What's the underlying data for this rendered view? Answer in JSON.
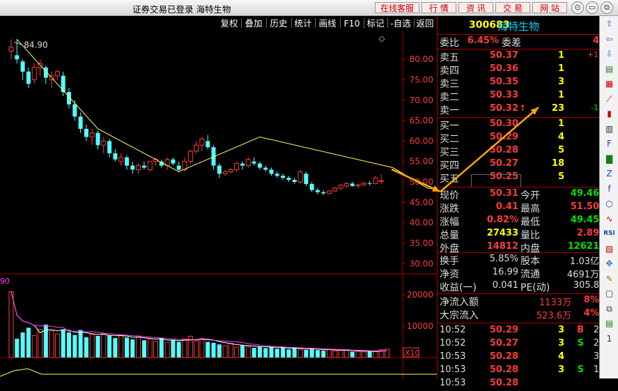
{
  "titlebar": {
    "title": "证券交易已登录  海特生物",
    "buttons": [
      "在线客服",
      "行 情",
      "资 讯",
      "交 易",
      "网 站"
    ],
    "win": [
      "⊙",
      "▭",
      "⧉",
      "✕"
    ]
  },
  "toolbar": {
    "items": [
      "复权",
      "叠加",
      "历史",
      "统计",
      "画线",
      "F10",
      "标记",
      "-自选",
      "返回"
    ]
  },
  "chart": {
    "price_ticks": [
      "80.00",
      "75.00",
      "70.00",
      "65.00",
      "60.00",
      "55.00",
      "50.00",
      "45.00",
      "40.00",
      "35.00",
      "30.00"
    ],
    "vol_ticks": [
      "20000",
      "10000"
    ],
    "vol_unit": "X10",
    "high_label": "84.90",
    "vol_corner": "90",
    "accent": "#ff3b3b"
  },
  "chart_data": {
    "type": "candlestick",
    "ylim": [
      28,
      86
    ],
    "candles": [
      [
        82,
        84.9,
        80,
        83
      ],
      [
        81,
        85,
        79,
        80
      ],
      [
        79.5,
        80,
        75,
        77
      ],
      [
        77,
        78,
        73,
        74
      ],
      [
        75,
        79,
        74,
        78
      ],
      [
        78,
        80,
        76,
        79
      ],
      [
        78,
        78.5,
        74,
        75.5
      ],
      [
        75,
        77,
        73,
        76
      ],
      [
        76,
        77.5,
        75,
        77
      ],
      [
        76,
        77,
        71,
        72
      ],
      [
        72,
        73,
        68,
        69
      ],
      [
        69,
        70,
        65,
        66
      ],
      [
        66,
        67,
        62,
        63
      ],
      [
        63,
        64,
        60,
        61
      ],
      [
        61,
        63,
        59,
        62
      ],
      [
        62,
        62.5,
        58,
        59
      ],
      [
        59,
        61,
        57,
        60
      ],
      [
        60,
        60.5,
        56,
        57
      ],
      [
        57,
        58,
        55,
        55.5
      ],
      [
        55,
        57,
        54,
        56
      ],
      [
        56,
        56.5,
        53,
        54
      ],
      [
        54,
        55,
        52,
        53
      ],
      [
        53,
        54.5,
        52,
        54
      ],
      [
        54,
        55,
        53,
        53.5
      ],
      [
        53,
        55,
        52.5,
        55
      ],
      [
        55,
        56,
        54,
        55.5
      ],
      [
        55,
        55.5,
        53.5,
        54
      ],
      [
        54,
        56,
        53,
        55.5
      ],
      [
        55.5,
        56,
        54,
        54.5
      ],
      [
        54,
        55,
        52.5,
        53
      ],
      [
        53,
        56,
        52.5,
        55
      ],
      [
        55,
        58,
        54.5,
        57.5
      ],
      [
        57.5,
        60,
        57,
        59
      ],
      [
        59,
        61,
        57.5,
        60.5
      ],
      [
        60,
        61.5,
        58,
        58.5
      ],
      [
        58.5,
        59,
        53,
        54
      ],
      [
        54,
        54.5,
        51,
        52
      ],
      [
        52,
        53,
        51.5,
        52.5
      ],
      [
        52.5,
        53.5,
        52,
        53
      ],
      [
        53,
        55,
        52.5,
        54.5
      ],
      [
        54.5,
        55,
        53,
        54
      ],
      [
        54,
        56,
        53.5,
        55.5
      ],
      [
        55,
        56,
        54,
        54.5
      ],
      [
        54.5,
        55,
        53,
        53.5
      ],
      [
        53.5,
        54,
        52.5,
        53
      ],
      [
        53,
        53.5,
        51.5,
        52
      ],
      [
        52,
        52.5,
        51,
        51.5
      ],
      [
        51.5,
        52,
        50.5,
        51
      ],
      [
        51,
        51.5,
        50,
        50.5
      ],
      [
        50.5,
        51,
        49.5,
        50
      ],
      [
        50,
        53,
        49.5,
        52.5
      ],
      [
        52,
        52.5,
        49,
        49.5
      ],
      [
        49.5,
        50,
        47.5,
        48
      ],
      [
        48,
        48.5,
        47,
        47.5
      ],
      [
        47.5,
        48,
        46.8,
        47.2
      ],
      [
        47.2,
        48,
        47,
        47.8
      ],
      [
        47.8,
        48.8,
        47.5,
        48.5
      ],
      [
        48.5,
        49.5,
        48,
        49.2
      ],
      [
        49,
        50,
        48.5,
        49.6
      ],
      [
        49.6,
        50,
        48.8,
        49
      ],
      [
        49,
        49.6,
        48.6,
        49.3
      ],
      [
        49.3,
        50,
        48.9,
        49.7
      ],
      [
        49.7,
        50.3,
        49.2,
        49.6
      ],
      [
        49.6,
        51.5,
        49.4,
        51
      ],
      [
        50.2,
        51.8,
        49.4,
        50.31
      ]
    ],
    "lines": [
      {
        "name": "",
        "points": [
          [
            1,
            84.9
          ],
          [
            15,
            63
          ],
          [
            29,
            52.5
          ],
          [
            43,
            61
          ],
          [
            66,
            53.5
          ],
          [
            72,
            48.5
          ],
          [
            83,
            46.8
          ],
          [
            96,
            51.8
          ]
        ]
      }
    ],
    "volume": [
      21000,
      6000,
      8000,
      9500,
      7000,
      9000,
      10500,
      8500,
      7500,
      9000,
      8000,
      7200,
      8800,
      6500,
      7400,
      6900,
      7600,
      7000,
      6200,
      7100,
      6400,
      5800,
      6900,
      5500,
      6000,
      5200,
      6300,
      4800,
      5600,
      5000,
      5900,
      6800,
      5400,
      6100,
      5000,
      4700,
      4200,
      3800,
      4500,
      3300,
      3900,
      3500,
      3100,
      3600,
      3000,
      3400,
      2800,
      3200,
      2600,
      3100,
      2700,
      2500,
      2900,
      2400,
      2200,
      2600,
      2100,
      2300,
      2400,
      1900,
      2000,
      1800,
      2100,
      1900,
      2500,
      2700
    ],
    "vol_ylim": [
      0,
      26000
    ]
  },
  "quote": {
    "code": "300683",
    "name": "海特生物",
    "weibi_label": "委比",
    "weibi_val": "6.45%",
    "weicha_label": "委差",
    "weicha_val": "4",
    "asks": [
      {
        "label": "卖五",
        "price": "50.37",
        "vol": "1",
        "chg": "+1",
        "chg_cls": "red",
        "arrow": ""
      },
      {
        "label": "卖四",
        "price": "50.36",
        "vol": "1",
        "chg": "",
        "chg_cls": "",
        "arrow": ""
      },
      {
        "label": "卖三",
        "price": "50.35",
        "vol": "3",
        "chg": "",
        "chg_cls": "",
        "arrow": ""
      },
      {
        "label": "卖二",
        "price": "50.33",
        "vol": "1",
        "chg": "",
        "chg_cls": "",
        "arrow": ""
      },
      {
        "label": "卖一",
        "price": "50.32",
        "vol": "23",
        "chg": "-1",
        "chg_cls": "grn",
        "arrow": "↑"
      }
    ],
    "bids": [
      {
        "label": "买一",
        "price": "50.30",
        "vol": "1"
      },
      {
        "label": "买二",
        "price": "50.29",
        "vol": "4"
      },
      {
        "label": "买三",
        "price": "50.28",
        "vol": "5"
      },
      {
        "label": "买四",
        "price": "50.27",
        "vol": "18"
      },
      {
        "label": "买五",
        "price": "50.25",
        "vol": "5"
      }
    ],
    "stats1": [
      {
        "l1": "现价",
        "v1": "50.31",
        "c1": "red",
        "l2": "今开",
        "v2": "49.46",
        "c2": "grn"
      },
      {
        "l1": "涨跌",
        "v1": "0.41",
        "c1": "red",
        "l2": "最高",
        "v2": "51.50",
        "c2": "red"
      },
      {
        "l1": "涨幅",
        "v1": "0.82%",
        "c1": "red",
        "l2": "最低",
        "v2": "49.45",
        "c2": "grn"
      },
      {
        "l1": "总量",
        "v1": "27433",
        "c1": "yel",
        "l2": "量比",
        "v2": "2.89",
        "c2": "red"
      },
      {
        "l1": "外盘",
        "v1": "14812",
        "c1": "red",
        "l2": "内盘",
        "v2": "12621",
        "c2": "grn"
      }
    ],
    "stats2": [
      {
        "l1": "换手",
        "v1": "5.85%",
        "l2": "股本",
        "v2": "1.03亿"
      },
      {
        "l1": "净资",
        "v1": "16.99",
        "l2": "流通",
        "v2": "4691万"
      },
      {
        "l1": "收益(一)",
        "v1": "0.041",
        "l2": "PE(动)",
        "v2": "305.8"
      }
    ],
    "flow": [
      {
        "label": "净流入额",
        "val": "1133万",
        "pct": "8%"
      },
      {
        "label": "大宗流入",
        "val": "523.6万",
        "pct": "4%"
      }
    ],
    "ticks": [
      {
        "time": "10:52",
        "price": "50.29",
        "vol": "3",
        "bs": "B",
        "bs_cls": "red",
        "n": "2"
      },
      {
        "time": "10:52",
        "price": "50.27",
        "vol": "3",
        "bs": "S",
        "bs_cls": "grn",
        "n": "2"
      },
      {
        "time": "10:53",
        "price": "50.28",
        "vol": "4",
        "bs": "",
        "bs_cls": "",
        "n": "3"
      },
      {
        "time": "10:53",
        "price": "50.28",
        "vol": "3",
        "bs": "S",
        "bs_cls": "grn",
        "n": "1"
      },
      {
        "time": "10:53",
        "price": "50.28",
        "vol": "",
        "bs": "",
        "bs_cls": "",
        "n": ""
      }
    ]
  },
  "sidebar_icons": [
    "up-arrow-icon",
    "left-arrow-icon",
    "down-arrow-icon",
    "report-icon",
    "table-icon",
    "line-chart-icon",
    "candle-icon",
    "chart-icon",
    "f10-icon",
    "bar-icon",
    "fiz-icon",
    "fx-icon",
    "circle-icon",
    "wave-icon",
    "rsi-icon",
    "doc-icon",
    "move-icon",
    "pen-icon",
    "doc2-icon",
    "copy-icon",
    "sheet-icon",
    "one-icon"
  ],
  "sidebar_glyphs": [
    "⇧",
    "⇦",
    "⇩",
    "▤",
    "▦",
    "⟋",
    "▮",
    "▥",
    "F",
    "▇",
    "Z",
    "f",
    "○",
    "∿",
    "RSI",
    "▨",
    "✥",
    "✎",
    "▢",
    "⧉",
    "▤",
    "1"
  ]
}
